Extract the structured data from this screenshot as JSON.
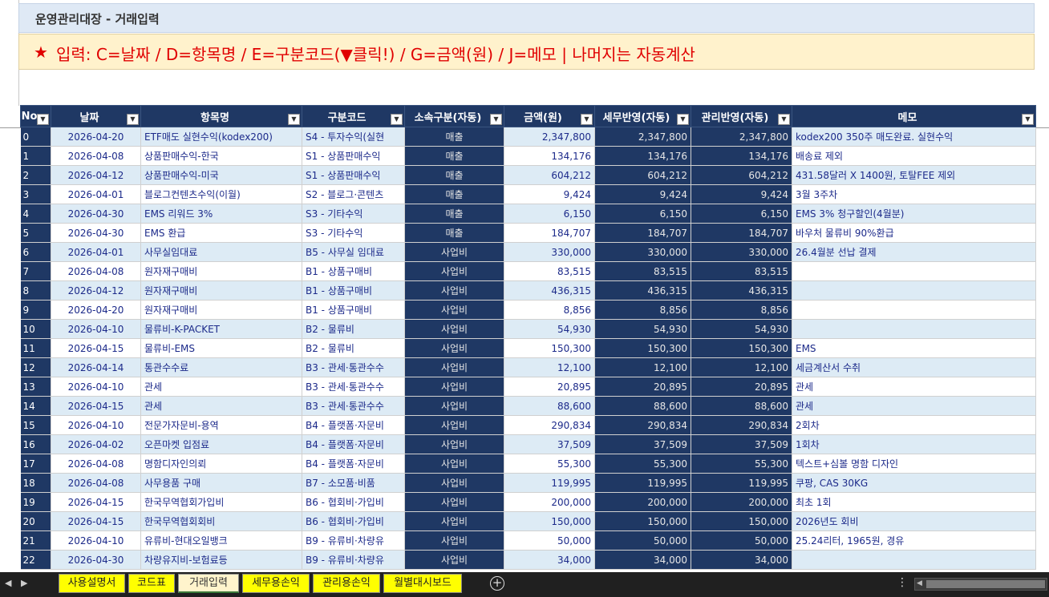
{
  "title": "운영관리대장 - 거래입력",
  "notice": {
    "star": "★",
    "text": "입력: C=날짜 / D=항목명 / E=구분코드(▼클릭!) / G=금액(원) / J=메모  |  나머지는 자동계산"
  },
  "headers": [
    "No",
    "날짜",
    "항목명",
    "구분코드",
    "소속구분(자동)",
    "금액(원)",
    "세무반영(자동)",
    "관리반영(자동)",
    "메모"
  ],
  "filter_icon": "▼",
  "rows": [
    {
      "no": "0",
      "date": "2026-04-20",
      "item": "ETF매도 실현수익(kodex200)",
      "code": "S4 - 투자수익(실현",
      "cat": "매출",
      "amount": "2,347,800",
      "tax": "2,347,800",
      "mgmt": "2,347,800",
      "memo": "kodex200 350주 매도완료. 실현수익"
    },
    {
      "no": "1",
      "date": "2026-04-08",
      "item": "상품판매수익-한국",
      "code": "S1 - 상품판매수익",
      "cat": "매출",
      "amount": "134,176",
      "tax": "134,176",
      "mgmt": "134,176",
      "memo": "배송료 제외"
    },
    {
      "no": "2",
      "date": "2026-04-12",
      "item": "상품판매수익-미국",
      "code": "S1 - 상품판매수익",
      "cat": "매출",
      "amount": "604,212",
      "tax": "604,212",
      "mgmt": "604,212",
      "memo": "431.58달러 X 1400원, 토탈FEE 제외"
    },
    {
      "no": "3",
      "date": "2026-04-01",
      "item": "블로그컨텐츠수익(이월)",
      "code": "S2 - 블로그·콘텐츠",
      "cat": "매출",
      "amount": "9,424",
      "tax": "9,424",
      "mgmt": "9,424",
      "memo": "3월 3주차"
    },
    {
      "no": "4",
      "date": "2026-04-30",
      "item": "EMS 리워드 3%",
      "code": "S3 - 기타수익",
      "cat": "매출",
      "amount": "6,150",
      "tax": "6,150",
      "mgmt": "6,150",
      "memo": "EMS 3% 청구할인(4월분)"
    },
    {
      "no": "5",
      "date": "2026-04-30",
      "item": "EMS 환급",
      "code": "S3 - 기타수익",
      "cat": "매출",
      "amount": "184,707",
      "tax": "184,707",
      "mgmt": "184,707",
      "memo": "바우처 물류비 90%환급"
    },
    {
      "no": "6",
      "date": "2026-04-01",
      "item": "사무실임대료",
      "code": "B5 - 사무실 임대료",
      "cat": "사업비",
      "amount": "330,000",
      "tax": "330,000",
      "mgmt": "330,000",
      "memo": "26.4월분 선납 결제"
    },
    {
      "no": "7",
      "date": "2026-04-08",
      "item": "원자재구매비",
      "code": "B1 - 상품구매비",
      "cat": "사업비",
      "amount": "83,515",
      "tax": "83,515",
      "mgmt": "83,515",
      "memo": ""
    },
    {
      "no": "8",
      "date": "2026-04-12",
      "item": "원자재구매비",
      "code": "B1 - 상품구매비",
      "cat": "사업비",
      "amount": "436,315",
      "tax": "436,315",
      "mgmt": "436,315",
      "memo": ""
    },
    {
      "no": "9",
      "date": "2026-04-20",
      "item": "원자재구매비",
      "code": "B1 - 상품구매비",
      "cat": "사업비",
      "amount": "8,856",
      "tax": "8,856",
      "mgmt": "8,856",
      "memo": ""
    },
    {
      "no": "10",
      "date": "2026-04-10",
      "item": "물류비-K-PACKET",
      "code": "B2 - 물류비",
      "cat": "사업비",
      "amount": "54,930",
      "tax": "54,930",
      "mgmt": "54,930",
      "memo": ""
    },
    {
      "no": "11",
      "date": "2026-04-15",
      "item": "물류비-EMS",
      "code": "B2 - 물류비",
      "cat": "사업비",
      "amount": "150,300",
      "tax": "150,300",
      "mgmt": "150,300",
      "memo": "EMS"
    },
    {
      "no": "12",
      "date": "2026-04-14",
      "item": "통관수수료",
      "code": "B3 - 관세·통관수수",
      "cat": "사업비",
      "amount": "12,100",
      "tax": "12,100",
      "mgmt": "12,100",
      "memo": "세금계산서 수취"
    },
    {
      "no": "13",
      "date": "2026-04-10",
      "item": "관세",
      "code": "B3 - 관세·통관수수",
      "cat": "사업비",
      "amount": "20,895",
      "tax": "20,895",
      "mgmt": "20,895",
      "memo": "관세"
    },
    {
      "no": "14",
      "date": "2026-04-15",
      "item": "관세",
      "code": "B3 - 관세·통관수수",
      "cat": "사업비",
      "amount": "88,600",
      "tax": "88,600",
      "mgmt": "88,600",
      "memo": "관세"
    },
    {
      "no": "15",
      "date": "2026-04-10",
      "item": "전문가자문비-용역",
      "code": "B4 - 플랫폼·자문비",
      "cat": "사업비",
      "amount": "290,834",
      "tax": "290,834",
      "mgmt": "290,834",
      "memo": "2회차"
    },
    {
      "no": "16",
      "date": "2026-04-02",
      "item": "오픈마켓 입점료",
      "code": "B4 - 플랫폼·자문비",
      "cat": "사업비",
      "amount": "37,509",
      "tax": "37,509",
      "mgmt": "37,509",
      "memo": "1회차"
    },
    {
      "no": "17",
      "date": "2026-04-08",
      "item": "명함디자인의뢰",
      "code": "B4 - 플랫폼·자문비",
      "cat": "사업비",
      "amount": "55,300",
      "tax": "55,300",
      "mgmt": "55,300",
      "memo": "텍스트+심볼 명함 디자인"
    },
    {
      "no": "18",
      "date": "2026-04-08",
      "item": "사무용품 구매",
      "code": "B7 - 소모품·비품",
      "cat": "사업비",
      "amount": "119,995",
      "tax": "119,995",
      "mgmt": "119,995",
      "memo": "쿠팡, CAS 30KG"
    },
    {
      "no": "19",
      "date": "2026-04-15",
      "item": "한국무역협회가입비",
      "code": "B6 - 협회비·가입비",
      "cat": "사업비",
      "amount": "200,000",
      "tax": "200,000",
      "mgmt": "200,000",
      "memo": "최초 1회"
    },
    {
      "no": "20",
      "date": "2026-04-15",
      "item": "한국무역협회회비",
      "code": "B6 - 협회비·가입비",
      "cat": "사업비",
      "amount": "150,000",
      "tax": "150,000",
      "mgmt": "150,000",
      "memo": "2026년도 회비"
    },
    {
      "no": "21",
      "date": "2026-04-10",
      "item": "유류비-현대오일뱅크",
      "code": "B9 - 유류비·차량유",
      "cat": "사업비",
      "amount": "50,000",
      "tax": "50,000",
      "mgmt": "50,000",
      "memo": "25.24리터, 1965원, 경유"
    },
    {
      "no": "22",
      "date": "2026-04-30",
      "item": "차량유지비-보험료등",
      "code": "B9 - 유류비·차량유",
      "cat": "사업비",
      "amount": "34,000",
      "tax": "34,000",
      "mgmt": "34,000",
      "memo": ""
    }
  ],
  "tabs": [
    "사용설명서",
    "코드표",
    "거래입력",
    "세무용손익",
    "관리용손익",
    "월별대시보드"
  ],
  "active_tab": "거래입력",
  "icons": {
    "prev": "◀",
    "next": "▶",
    "add": "+",
    "more": "⋮",
    "scroll_left": "◀"
  }
}
